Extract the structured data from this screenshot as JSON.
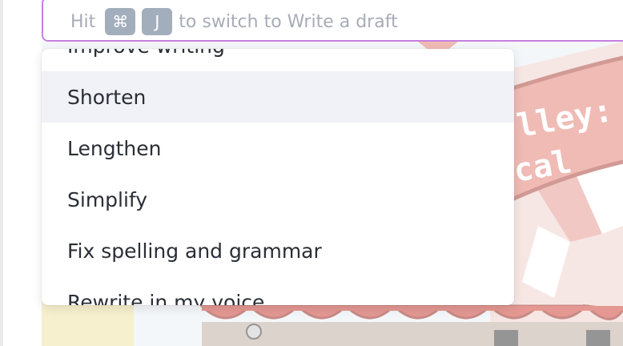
{
  "prompt": {
    "hint_prefix": "Hit",
    "key_cmd": "⌘",
    "key_j": "J",
    "hint_suffix": "to switch to Write a draft"
  },
  "menu": {
    "items": [
      {
        "label": "Improve writing"
      },
      {
        "label": "Shorten",
        "highlighted": true
      },
      {
        "label": "Lengthen"
      },
      {
        "label": "Simplify"
      },
      {
        "label": "Fix spelling and grammar"
      },
      {
        "label": "Rewrite in my voice"
      }
    ]
  },
  "background_art": {
    "banner_text_line1": "lley:",
    "banner_text_line2": "cal"
  },
  "colors": {
    "prompt_border": "#c77fe0",
    "menu_highlight": "#f1f2f7",
    "keycap": "#a3aebc"
  }
}
